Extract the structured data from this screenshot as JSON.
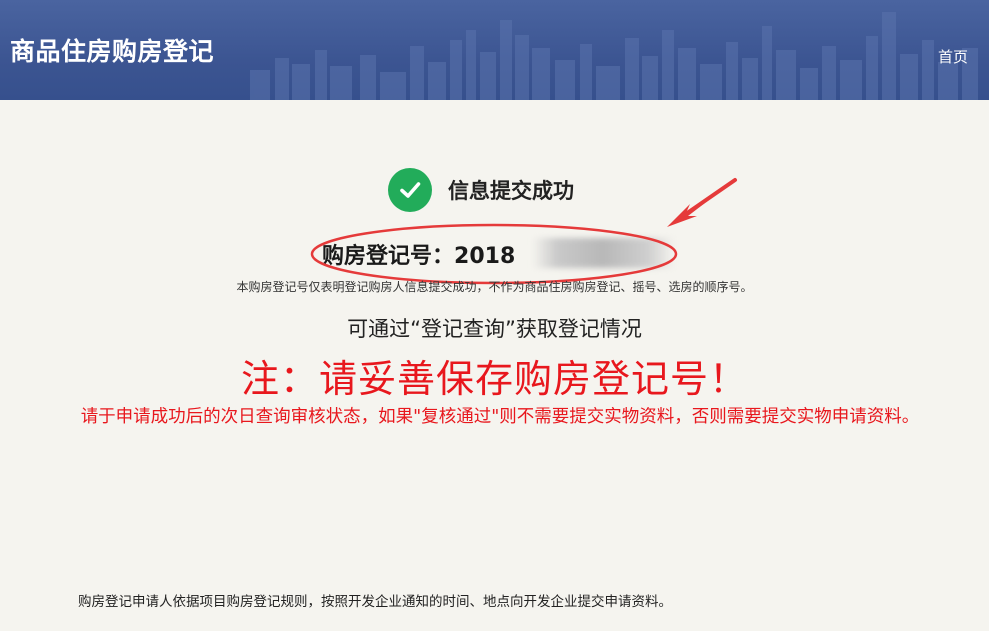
{
  "header": {
    "title": "商品住房购房登记",
    "nav_home": "首页"
  },
  "result": {
    "success_icon": "check-circle-icon",
    "success_text": "信息提交成功",
    "reg_label": "购房登记号：",
    "reg_number_visible": "2018",
    "disclaimer": "本购房登记号仅表明登记购房人信息提交成功，不作为商品住房购房登记、摇号、选房的顺序号。"
  },
  "query": {
    "text": "可通过“登记查询”获取登记情况"
  },
  "notice": {
    "headline": "注：请妥善保存购房登记号！",
    "detail": "请于申请成功后的次日查询审核状态，如果\"复核通过\"则不需要提交实物资料，否则需要提交实物申请资料。"
  },
  "footer": {
    "note": "购房登记申请人依据项目购房登记规则，按照开发企业通知的时间、地点向开发企业提交申请资料。"
  },
  "colors": {
    "header_bg": "#3c5592",
    "success_green": "#22ac5a",
    "notice_red": "#e8171d",
    "annotation_red": "#e53a3a"
  }
}
